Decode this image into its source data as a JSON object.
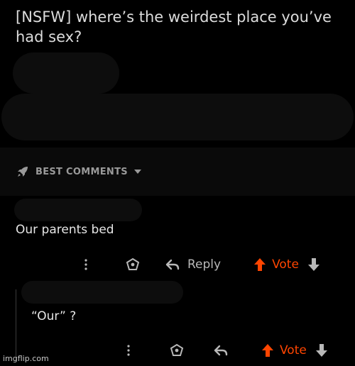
{
  "post": {
    "title": "[NSFW] where’s the weirdest place you’ve had sex?"
  },
  "sort": {
    "label": "BEST COMMENTS",
    "icon": "rocket-icon",
    "caret_icon": "caret-down-icon"
  },
  "comments": [
    {
      "text": "Our parents bed",
      "actions": {
        "more_icon": "more-vertical-icon",
        "award_icon": "award-icon",
        "reply_label": "Reply",
        "vote_label": "Vote"
      }
    },
    {
      "text": "“Our” ?",
      "actions": {
        "more_icon": "more-vertical-icon",
        "award_icon": "award-icon",
        "vote_label": "Vote"
      }
    }
  ],
  "colors": {
    "background": "#000000",
    "accent_vote": "#ff4500",
    "muted": "#9a9a9a"
  },
  "watermark": "imgflip.com"
}
